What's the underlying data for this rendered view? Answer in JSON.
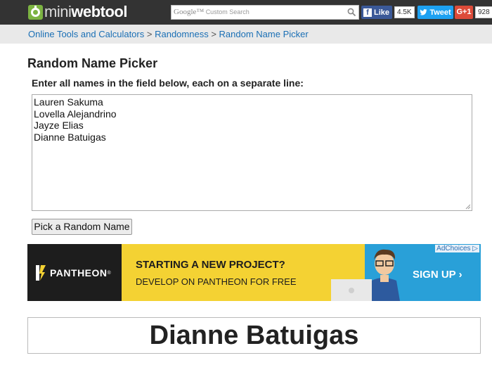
{
  "header": {
    "logo_mini": "mini",
    "logo_web": "webtool",
    "search": {
      "google_label": "Google™",
      "placeholder": "Custom Search",
      "icon": "search-icon"
    },
    "facebook": {
      "label": "Like",
      "count": "4.5K"
    },
    "twitter": {
      "label": "Tweet"
    },
    "gplus": {
      "label": "G+1",
      "count": "928"
    }
  },
  "breadcrumb": {
    "items": [
      "Online Tools and Calculators",
      "Randomness",
      "Random Name Picker"
    ],
    "separator": ">"
  },
  "main": {
    "title": "Random Name Picker",
    "instructions": "Enter all names in the field below, each on a separate line:",
    "names": [
      "Lauren Sakuma",
      "Lovella Alejandrino",
      "Jayze Elias",
      "Dianne Batuigas"
    ],
    "pick_button": "Pick a Random Name"
  },
  "ad": {
    "brand": "PANTHEON",
    "headline": "STARTING A NEW PROJECT?",
    "subline": "DEVELOP ON PANTHEON FOR FREE",
    "cta": "SIGN UP ›",
    "adchoices": "AdChoices ▷"
  },
  "result": {
    "name": "Dianne Batuigas"
  },
  "colors": {
    "topbar": "#333333",
    "logo_green": "#7cb342",
    "link": "#1a6fb5",
    "facebook": "#3b5998",
    "twitter": "#1da1f2",
    "gplus": "#dd4b39",
    "ad_yellow": "#f4d233",
    "ad_blue": "#29a0d8"
  }
}
